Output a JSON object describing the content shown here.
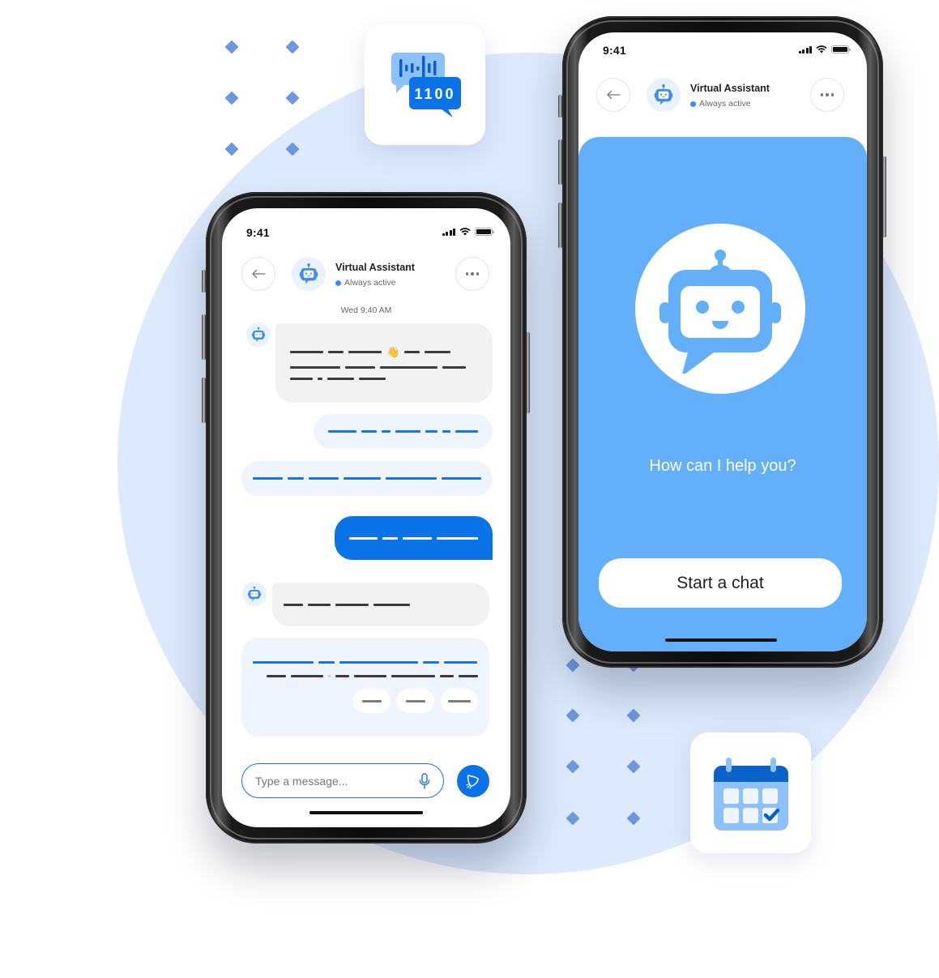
{
  "colors": {
    "primary_blue": "#0b73e8",
    "light_blue_panel": "#64aff9",
    "background_circle": "#dde9fc",
    "diamond": "#6b98de",
    "bubble_grey": "#f1f2f4",
    "bubble_light": "#eef5fe",
    "status_dot": "#3d8ef0"
  },
  "decorations": {
    "voice_to_text_tile": {
      "icon": "voice-to-binary-chat-icon",
      "binary_text": "1100"
    },
    "calendar_tile": {
      "icon": "calendar-check-icon"
    }
  },
  "chat_phone": {
    "status_bar": {
      "time": "9:41"
    },
    "header": {
      "back_icon": "arrow-left-icon",
      "bot_name": "Virtual Assistant",
      "bot_status": "Always active",
      "more_icon": "more-horizontal-icon"
    },
    "date_label": "Wed 9:40 AM",
    "messages": [
      {
        "sender": "bot",
        "style": "grey",
        "placeholder_text": true,
        "emoji": "👋"
      },
      {
        "sender": "user",
        "style": "light",
        "placeholder_text": true
      },
      {
        "sender": "user",
        "style": "light",
        "placeholder_text": true
      },
      {
        "sender": "user",
        "style": "blue",
        "placeholder_text": true
      },
      {
        "sender": "bot",
        "style": "grey",
        "placeholder_text": true
      },
      {
        "sender": "bot",
        "style": "light-card",
        "placeholder_text": true,
        "quick_reply_count": 3
      }
    ],
    "composer": {
      "placeholder": "Type a message...",
      "value": "",
      "mic_icon": "microphone-icon",
      "send_icon": "send-icon"
    }
  },
  "welcome_phone": {
    "status_bar": {
      "time": "9:41"
    },
    "header": {
      "back_icon": "arrow-left-icon",
      "bot_name": "Virtual Assistant",
      "bot_status": "Always active",
      "more_icon": "more-horizontal-icon"
    },
    "hero_icon": "chatbot-icon",
    "prompt": "How can I help you?",
    "start_button": "Start a chat"
  }
}
